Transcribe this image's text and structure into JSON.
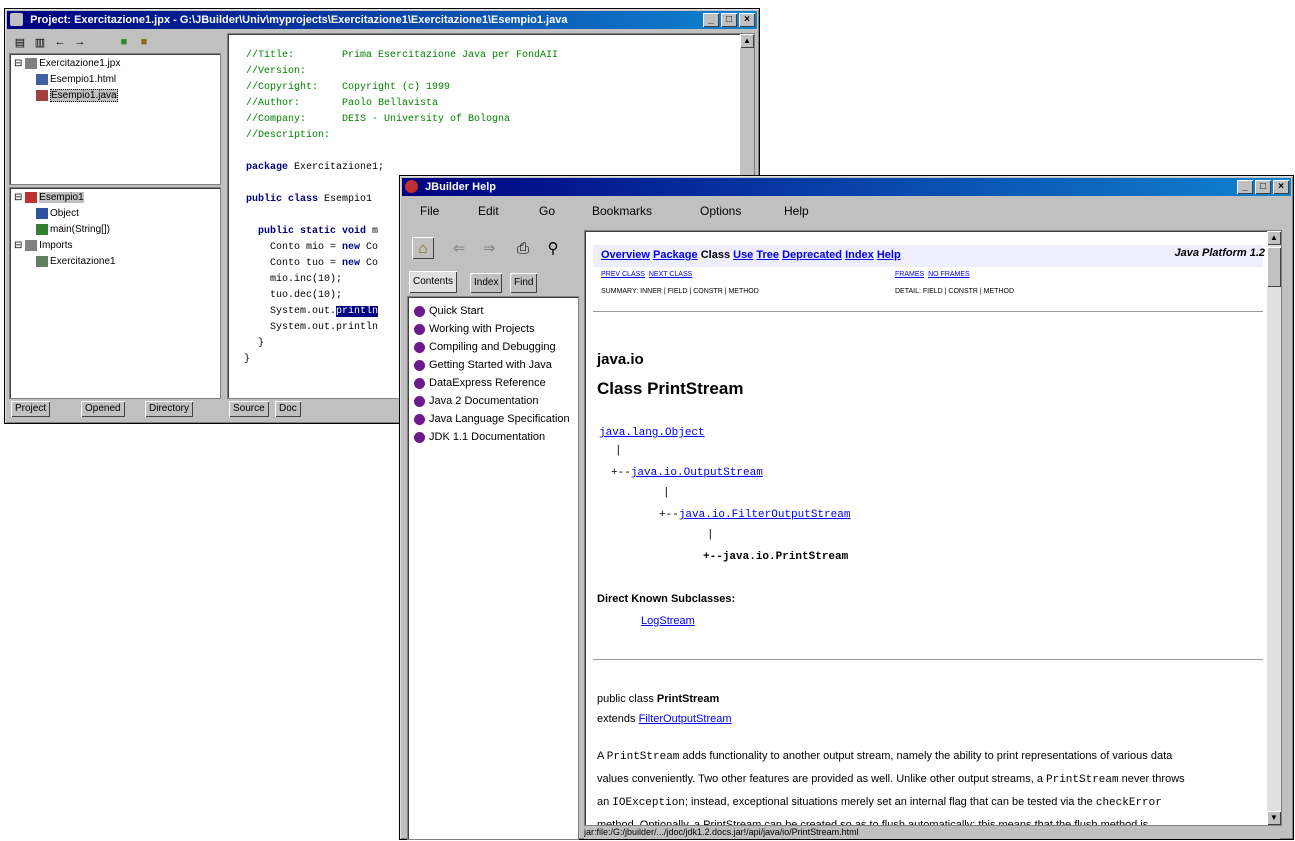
{
  "project_window": {
    "title": "Project: Exercitazione1.jpx - G:\\JBuilder\\Univ\\myprojects\\Exercitazione1\\Exercitazione1\\Esempio1.java",
    "tree_top": [
      "Exercitazione1.jpx",
      "Esempio1.html",
      "Esempio1.java"
    ],
    "tree_bottom": [
      "Esempio1",
      "Object",
      "main(String[])",
      "Imports",
      "Exercitazione1"
    ],
    "bottom_tabs": [
      "Project",
      "Opened",
      "Directory"
    ],
    "editor_tabs": [
      "Source",
      "Doc"
    ],
    "code": {
      "c1": "//Title:        Prima Esercitazione Java per FondAII",
      "c2": "//Version:",
      "c3": "//Copyright:    Copyright (c) 1999",
      "c4": "//Author:       Paolo Bellavista",
      "c5": "//Company:      DEIS - University of Bologna",
      "c6": "//Description:",
      "pkg_kw": "package",
      "pkg_rest": " Exercitazione1;",
      "cls_kw": "public class",
      "cls_rest": " Esempio1",
      "main_kw": "public static void",
      "main_rest": " m",
      "l1a": "  Conto mio = ",
      "l1kw": "new",
      "l1b": " Co",
      "l2a": "  Conto tuo = ",
      "l2kw": "new",
      "l2b": " Co",
      "l3": "  mio.inc(10);",
      "l4": "  tuo.dec(10);",
      "l5a": "  System.out.",
      "l5sel": "println",
      "l6": "  System.out.println",
      "l7": "}",
      "l8": "}"
    }
  },
  "help_window": {
    "title": "JBuilder Help",
    "menu": [
      "File",
      "Edit",
      "Go",
      "Bookmarks",
      "Options",
      "Help"
    ],
    "toc_tabs": [
      "Contents",
      "Index",
      "Find"
    ],
    "toc_items": [
      "Quick Start",
      "Working with Projects",
      "Compiling and Debugging",
      "Getting Started with Java",
      "DataExpress Reference",
      "Java 2 Documentation",
      "Java Language Specification",
      "JDK 1.1 Documentation"
    ],
    "nav": [
      "Overview",
      "Package",
      "Class",
      "Use",
      "Tree",
      "Deprecated",
      "Index",
      "Help"
    ],
    "platform": "Java Platform 1.2",
    "sub_nav_left": [
      "PREV CLASS",
      "NEXT CLASS"
    ],
    "sub_nav_right": [
      "FRAMES",
      "NO FRAMES"
    ],
    "summary_left": "SUMMARY: INNER | FIELD | CONSTR | METHOD",
    "detail_right": "DETAIL: FIELD | CONSTR | METHOD",
    "package_name": "java.io",
    "class_title": "Class PrintStream",
    "hierarchy": [
      "java.lang.Object",
      "java.io.OutputStream",
      "java.io.FilterOutputStream",
      "java.io.PrintStream"
    ],
    "pipe": "|",
    "arrow": "+--",
    "subclasses_heading": "Direct Known Subclasses:",
    "subclass": "LogStream",
    "decl_prefix": "public class ",
    "decl_class": "PrintStream",
    "extends_label": "extends ",
    "extends_link": "FilterOutputStream",
    "desc": {
      "p1a": "A ",
      "p1code": "PrintStream",
      "p1b": " adds functionality to another output stream, namely the ability to print representations of various data",
      "p2a": "values conveniently. Two other features are provided as well. Unlike other output streams, a ",
      "p2code": "PrintStream",
      "p2b": " never throws",
      "p3a": "an ",
      "p3code": "IOException",
      "p3b": "; instead, exceptional situations merely set an internal flag that can be tested via the ",
      "p3code2": "checkError",
      "p4": "method. Optionally, a PrintStream can be created so as to flush automatically; this means that the flush method is"
    },
    "status": "jar:file:/G:/jbuilder/.../jdoc/jdk1.2.docs.jar!/api/java/io/PrintStream.html"
  },
  "colors": {
    "titlebar": "#000080",
    "link": "#0000ee",
    "comment": "#008000",
    "keyword": "#000080",
    "bullet": "#6a1a8a"
  }
}
